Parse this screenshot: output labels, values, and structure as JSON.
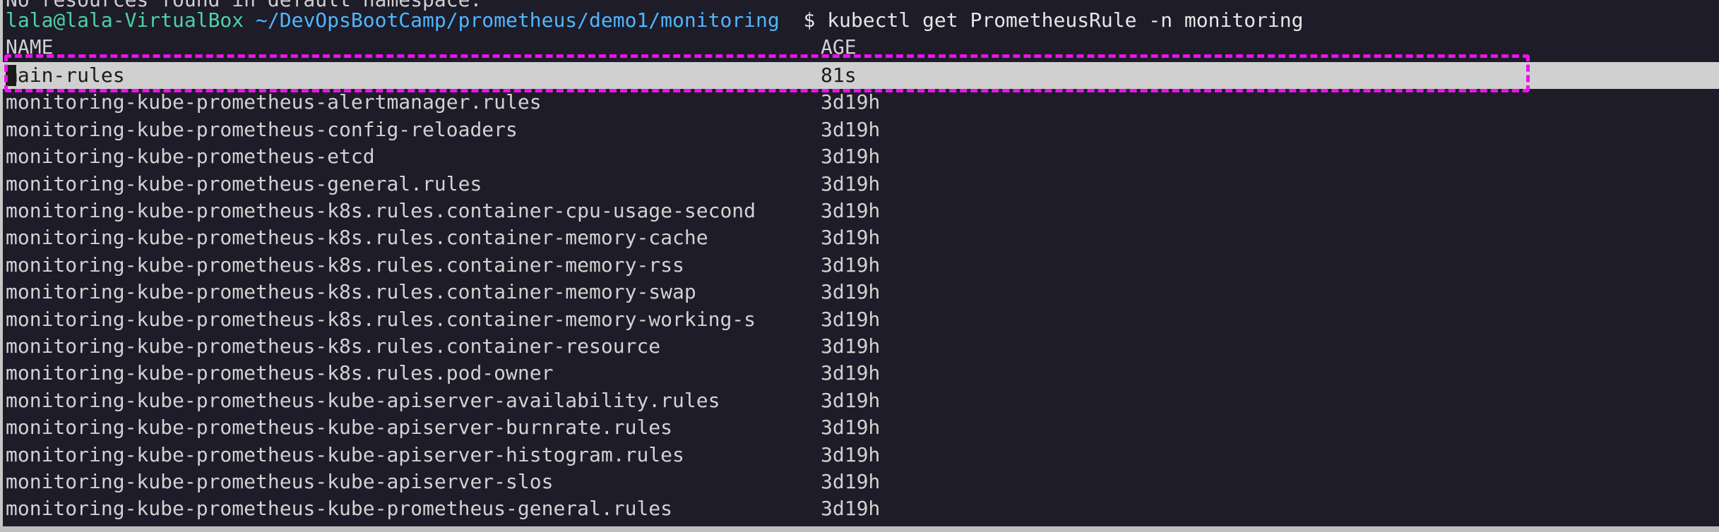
{
  "terminal": {
    "cut_off_line": "No resources found in default namespace.",
    "prompt": {
      "user_host": "lala@lala-VirtualBox",
      "path": "~/DevOpsBootCamp/prometheus/demo1/monitoring",
      "symbol": "$",
      "command": "kubectl get PrometheusRule -n monitoring"
    },
    "columns": {
      "name": "NAME",
      "age": "AGE"
    },
    "rows": [
      {
        "name": "main-rules",
        "age": "81s"
      },
      {
        "name": "monitoring-kube-prometheus-alertmanager.rules",
        "age": "3d19h"
      },
      {
        "name": "monitoring-kube-prometheus-config-reloaders",
        "age": "3d19h"
      },
      {
        "name": "monitoring-kube-prometheus-etcd",
        "age": "3d19h"
      },
      {
        "name": "monitoring-kube-prometheus-general.rules",
        "age": "3d19h"
      },
      {
        "name": "monitoring-kube-prometheus-k8s.rules.container-cpu-usage-second",
        "age": "3d19h"
      },
      {
        "name": "monitoring-kube-prometheus-k8s.rules.container-memory-cache",
        "age": "3d19h"
      },
      {
        "name": "monitoring-kube-prometheus-k8s.rules.container-memory-rss",
        "age": "3d19h"
      },
      {
        "name": "monitoring-kube-prometheus-k8s.rules.container-memory-swap",
        "age": "3d19h"
      },
      {
        "name": "monitoring-kube-prometheus-k8s.rules.container-memory-working-s",
        "age": "3d19h"
      },
      {
        "name": "monitoring-kube-prometheus-k8s.rules.container-resource",
        "age": "3d19h"
      },
      {
        "name": "monitoring-kube-prometheus-k8s.rules.pod-owner",
        "age": "3d19h"
      },
      {
        "name": "monitoring-kube-prometheus-kube-apiserver-availability.rules",
        "age": "3d19h"
      },
      {
        "name": "monitoring-kube-prometheus-kube-apiserver-burnrate.rules",
        "age": "3d19h"
      },
      {
        "name": "monitoring-kube-prometheus-kube-apiserver-histogram.rules",
        "age": "3d19h"
      },
      {
        "name": "monitoring-kube-prometheus-kube-apiserver-slos",
        "age": "3d19h"
      },
      {
        "name": "monitoring-kube-prometheus-kube-prometheus-general.rules",
        "age": "3d19h"
      }
    ],
    "selected_row": 0,
    "colors": {
      "background": "#1d1c28",
      "text": "#d2d2d2",
      "prompt_user": "#4fd1a5",
      "prompt_path": "#50b6ff",
      "selection_bg": "#d0d0d0",
      "highlight_border": "#ee10ee"
    }
  }
}
